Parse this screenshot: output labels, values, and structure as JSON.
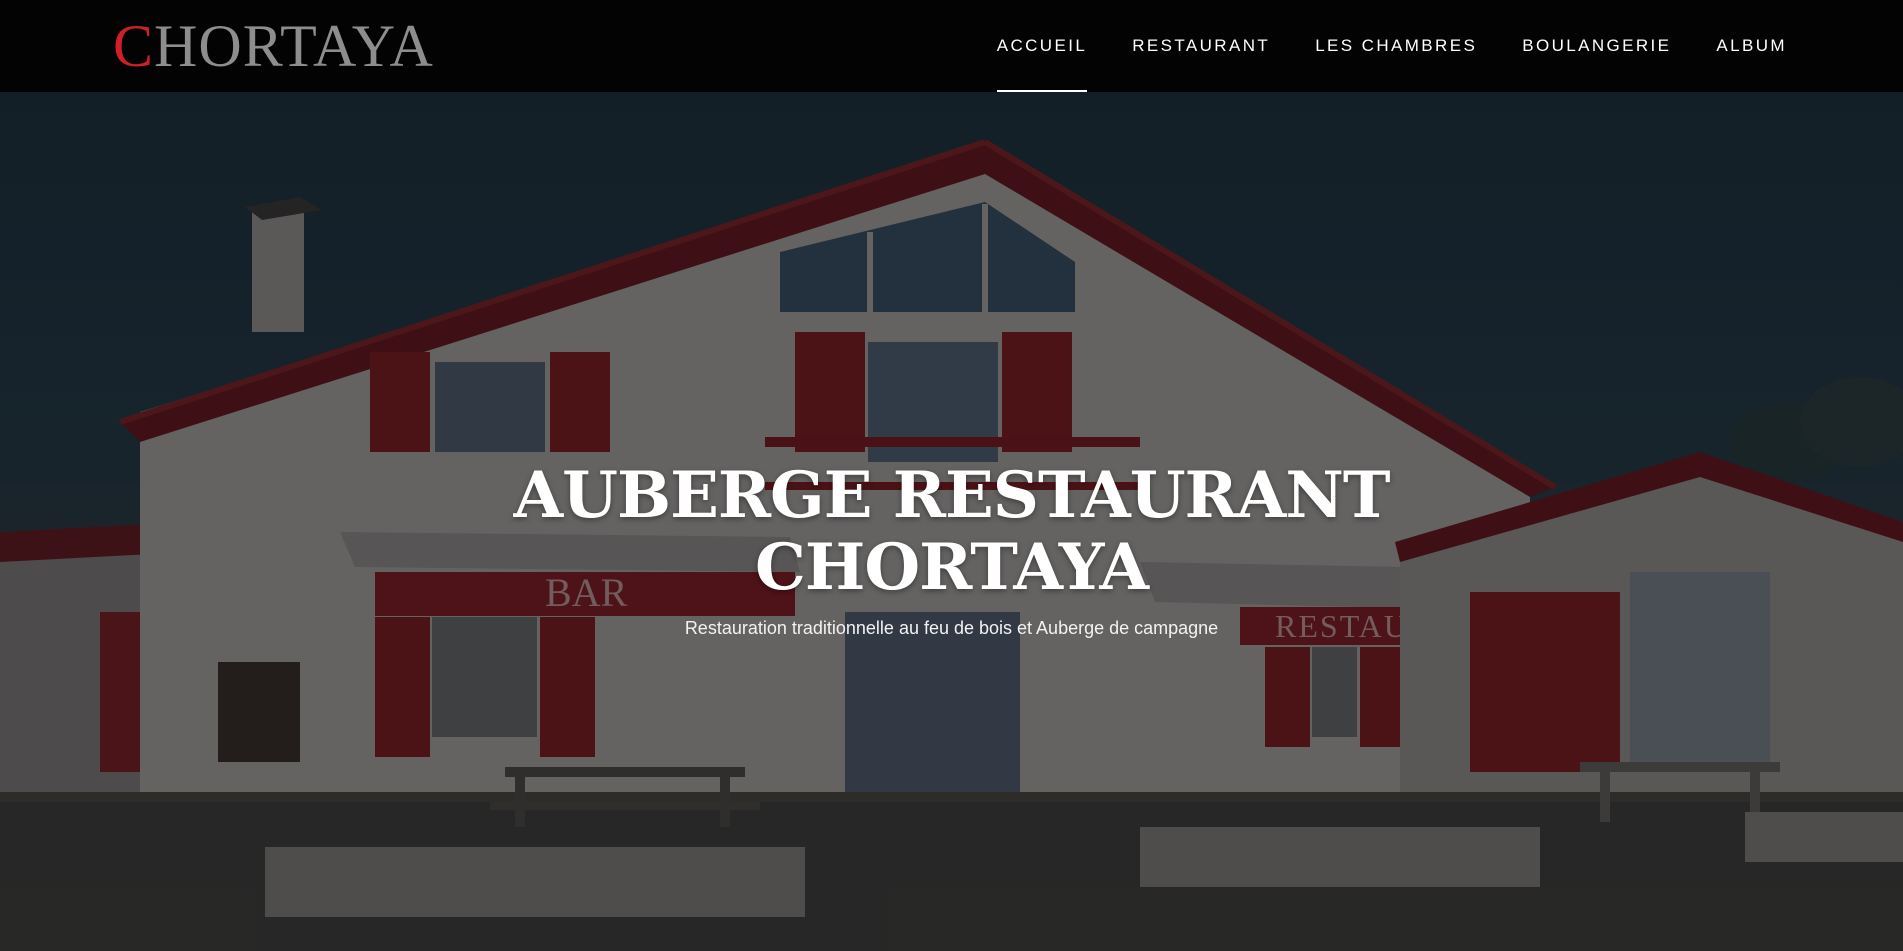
{
  "header": {
    "logo_first_letter": "C",
    "logo_rest": "HORTAYA",
    "nav": [
      {
        "label": "ACCUEIL",
        "active": true
      },
      {
        "label": "RESTAURANT",
        "active": false
      },
      {
        "label": "LES CHAMBRES",
        "active": false
      },
      {
        "label": "BOULANGERIE",
        "active": false
      },
      {
        "label": "ALBUM",
        "active": false
      }
    ]
  },
  "hero": {
    "title_line1": "AUBERGE RESTAURANT",
    "title_line2": "CHORTAYA",
    "subtitle": "Restauration traditionnelle au feu de bois et Auberge de campagne",
    "sign_bar": "BAR",
    "sign_restaurant": "RESTAURANT"
  },
  "colors": {
    "logo_accent": "#d01f26",
    "logo_text": "#8d8d8d",
    "header_bg": "#030303",
    "nav_text": "#ffffff",
    "shutter_red": "#6e1a1f"
  }
}
